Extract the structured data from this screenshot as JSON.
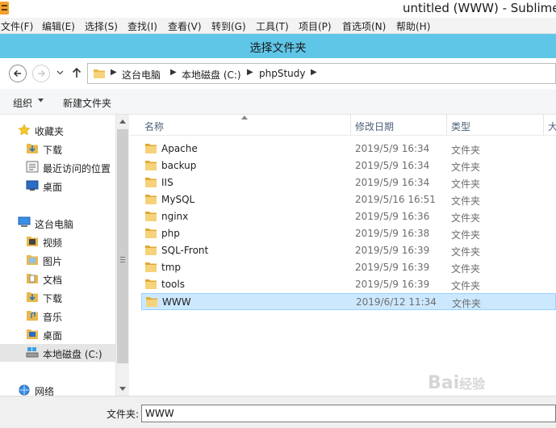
{
  "app": {
    "title": "untitled (WWW) - Sublime"
  },
  "menu": {
    "items": [
      "文件(F)",
      "编辑(E)",
      "选择(S)",
      "查找(I)",
      "查看(V)",
      "转到(G)",
      "工具(T)",
      "项目(P)",
      "首选项(N)",
      "帮助(H)"
    ]
  },
  "dialog": {
    "title": "选择文件夹",
    "address": {
      "segments": [
        "这台电脑",
        "本地磁盘 (C:)",
        "phpStudy"
      ]
    },
    "toolbar": {
      "organize_label": "组织",
      "new_folder_label": "新建文件夹"
    },
    "nav": {
      "favorites": "收藏夹",
      "favorites_items": [
        "下载",
        "最近访问的位置",
        "桌面"
      ],
      "this_pc": "这台电脑",
      "pc_items": [
        "视频",
        "图片",
        "文档",
        "下载",
        "音乐",
        "桌面",
        "本地磁盘 (C:)"
      ],
      "network": "网络"
    },
    "columns": {
      "name": "名称",
      "modified": "修改日期",
      "type": "类型",
      "size": "大"
    },
    "files": [
      {
        "name": "Apache",
        "modified": "2019/5/9 16:34",
        "type": "文件夹"
      },
      {
        "name": "backup",
        "modified": "2019/5/9 16:34",
        "type": "文件夹"
      },
      {
        "name": "IIS",
        "modified": "2019/5/9 16:34",
        "type": "文件夹"
      },
      {
        "name": "MySQL",
        "modified": "2019/5/16 16:51",
        "type": "文件夹"
      },
      {
        "name": "nginx",
        "modified": "2019/5/9 16:36",
        "type": "文件夹"
      },
      {
        "name": "php",
        "modified": "2019/5/9 16:38",
        "type": "文件夹"
      },
      {
        "name": "SQL-Front",
        "modified": "2019/5/9 16:39",
        "type": "文件夹"
      },
      {
        "name": "tmp",
        "modified": "2019/5/9 16:39",
        "type": "文件夹"
      },
      {
        "name": "tools",
        "modified": "2019/5/9 16:39",
        "type": "文件夹"
      },
      {
        "name": "WWW",
        "modified": "2019/6/12 11:34",
        "type": "文件夹"
      }
    ],
    "selected_file": "WWW",
    "folder_field": {
      "label": "文件夹:",
      "value": "WWW"
    }
  },
  "watermark": {
    "text": "Bai",
    "suffix": "经验"
  }
}
